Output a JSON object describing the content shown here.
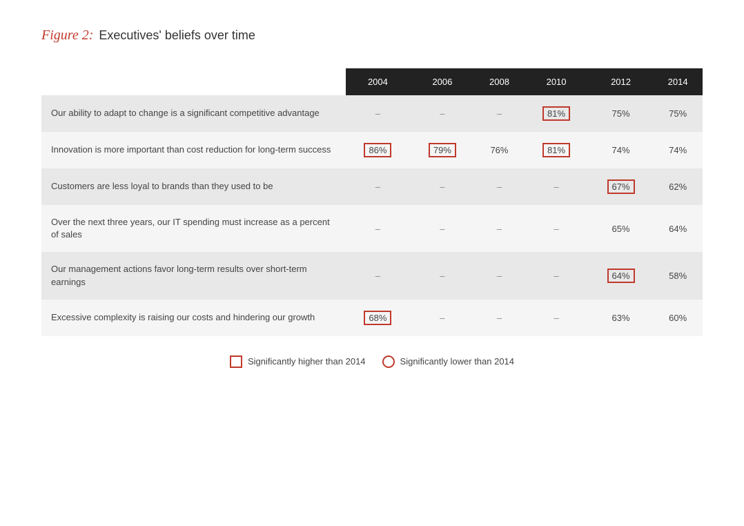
{
  "figure": {
    "label": "Figure 2:",
    "description": "Executives' beliefs over time"
  },
  "table": {
    "columns": [
      "",
      "2004",
      "2006",
      "2008",
      "2010",
      "2012",
      "2014"
    ],
    "rows": [
      {
        "label": "Our ability to adapt to change is a significant competitive advantage",
        "values": [
          "–",
          "–",
          "–",
          "81%",
          "75%",
          "75%"
        ],
        "highlights": [
          null,
          null,
          null,
          "box",
          null,
          null
        ]
      },
      {
        "label": "Innovation is more important than cost reduction for long-term success",
        "values": [
          "86%",
          "79%",
          "76%",
          "81%",
          "74%",
          "74%"
        ],
        "highlights": [
          "box",
          "box",
          null,
          "box",
          null,
          null
        ]
      },
      {
        "label": "Customers are less loyal to brands than they used to be",
        "values": [
          "–",
          "–",
          "–",
          "–",
          "67%",
          "62%"
        ],
        "highlights": [
          null,
          null,
          null,
          null,
          "box",
          null
        ]
      },
      {
        "label": "Over the next three years, our IT spending must increase as a percent of sales",
        "values": [
          "–",
          "–",
          "–",
          "–",
          "65%",
          "64%"
        ],
        "highlights": [
          null,
          null,
          null,
          null,
          null,
          null
        ]
      },
      {
        "label": "Our management actions favor long-term results over short-term earnings",
        "values": [
          "–",
          "–",
          "–",
          "–",
          "64%",
          "58%"
        ],
        "highlights": [
          null,
          null,
          null,
          null,
          "box",
          null
        ]
      },
      {
        "label": "Excessive complexity is raising our costs and hindering our growth",
        "values": [
          "68%",
          "–",
          "–",
          "–",
          "63%",
          "60%"
        ],
        "highlights": [
          "box",
          null,
          null,
          null,
          null,
          null
        ]
      }
    ]
  },
  "legend": {
    "higher_label": "Significantly higher than 2014",
    "lower_label": "Significantly lower than 2014"
  }
}
